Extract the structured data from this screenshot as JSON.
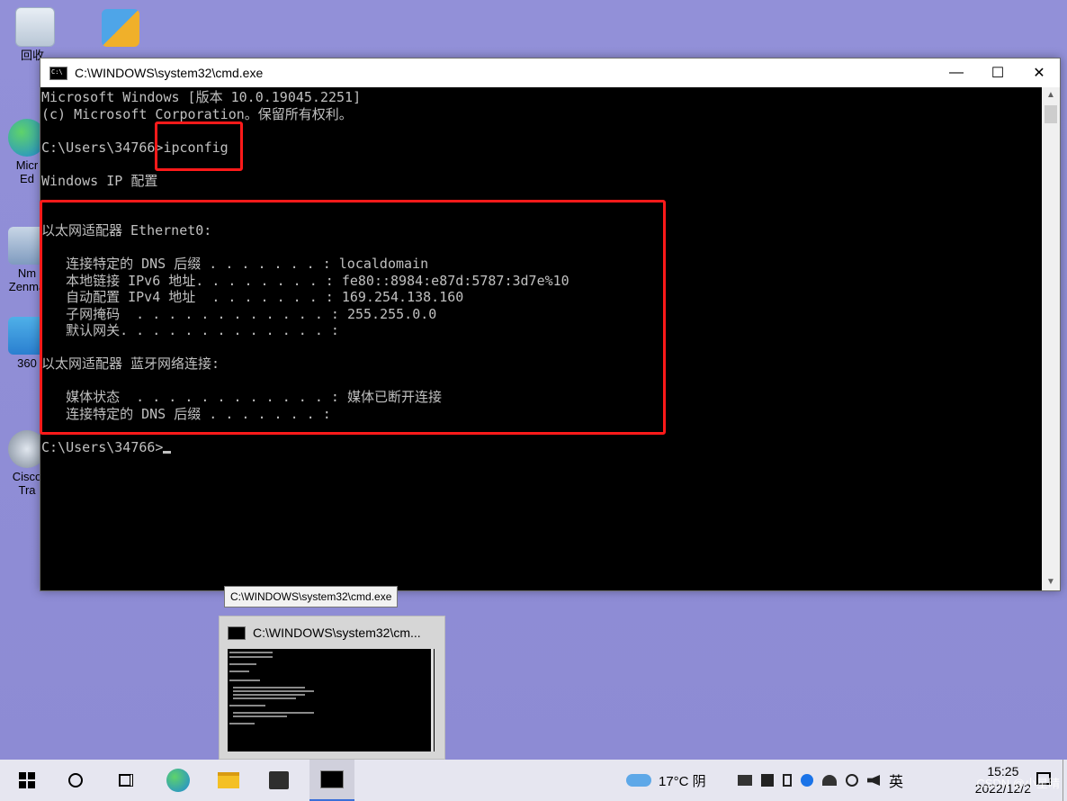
{
  "desktop": {
    "icons": [
      {
        "label": "回收",
        "icon": "recycle-bin-icon"
      },
      {
        "label": "360",
        "icon": "360-security-icon"
      },
      {
        "label": "Micr\nEd",
        "icon": "edge-shortcut-icon"
      },
      {
        "label": "Nm\nZenma",
        "icon": "nmap-zenmap-icon"
      },
      {
        "label": "360",
        "icon": "360-zip-icon"
      },
      {
        "label": "Cisco\nTra",
        "icon": "cisco-packet-tracer-icon"
      }
    ]
  },
  "cmd_window": {
    "title": "C:\\WINDOWS\\system32\\cmd.exe",
    "controls": {
      "minimize": "—",
      "maximize": "☐",
      "close": "✕"
    },
    "lines": [
      "Microsoft Windows [版本 10.0.19045.2251]",
      "(c) Microsoft Corporation。保留所有权利。",
      "",
      "C:\\Users\\34766>ipconfig",
      "",
      "Windows IP 配置",
      "",
      "",
      "以太网适配器 Ethernet0:",
      "",
      "   连接特定的 DNS 后缀 . . . . . . . : localdomain",
      "   本地链接 IPv6 地址. . . . . . . . : fe80::8984:e87d:5787:3d7e%10",
      "   自动配置 IPv4 地址  . . . . . . . : 169.254.138.160",
      "   子网掩码  . . . . . . . . . . . . : 255.255.0.0",
      "   默认网关. . . . . . . . . . . . . :",
      "",
      "以太网适配器 蓝牙网络连接:",
      "",
      "   媒体状态  . . . . . . . . . . . . : 媒体已断开连接",
      "   连接特定的 DNS 后缀 . . . . . . . :",
      ""
    ],
    "prompt": "C:\\Users\\34766>",
    "scroll_up": "▲",
    "scroll_down": "▼",
    "highlight_color": "#ff1a1a"
  },
  "tooltip": "C:\\WINDOWS\\system32\\cmd.exe",
  "thumbnail": {
    "title": "C:\\WINDOWS\\system32\\cm..."
  },
  "taskbar": {
    "weather": "17°C 阴",
    "ime": "英",
    "time": "15:25",
    "date": "2022/12/2",
    "watermark": "CSDN @小星晴",
    "tray_icons": [
      "vmware-tray-icon",
      "security-tray-icon",
      "usb-tray-icon",
      "bluetooth-tray-icon",
      "network-tray-icon",
      "globe-icon",
      "volume-icon"
    ]
  },
  "colors": {
    "desktop": "#8e8cd6",
    "console_text": "#c0c0c0",
    "edge": "#1e88d8",
    "explorer": "#f4c025"
  }
}
